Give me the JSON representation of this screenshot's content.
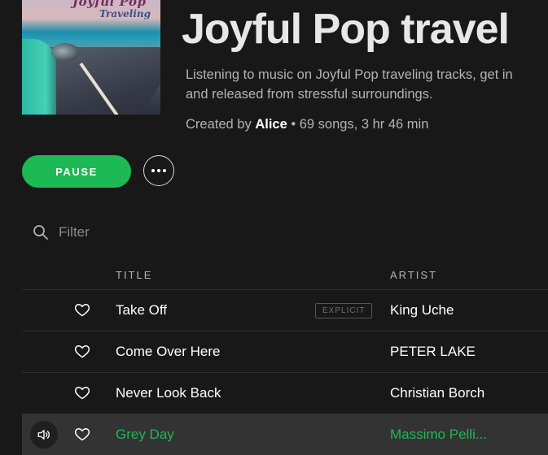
{
  "cover": {
    "line1": "Joyful Pop",
    "line2": "Traveling"
  },
  "playlist": {
    "title": "Joyful Pop travel",
    "description_line1": "Listening to music on Joyful Pop traveling tracks, get in",
    "description_line2": "and released from stressful surroundings.",
    "created_by": "Created by",
    "owner": "Alice",
    "stats": "• 69 songs, 3 hr 46 min"
  },
  "controls": {
    "pause_label": "PAUSE",
    "more_icon": "ellipsis-icon"
  },
  "filter": {
    "placeholder": "Filter",
    "icon": "search-icon"
  },
  "columns": {
    "title": "TITLE",
    "artist": "ARTIST"
  },
  "tracks": [
    {
      "title": "Take Off",
      "artist": "King Uche",
      "explicit": "EXPLICIT"
    },
    {
      "title": "Come Over Here",
      "artist": "PETER LAKE"
    },
    {
      "title": "Never Look Back",
      "artist": "Christian Borch"
    },
    {
      "title": "Grey Day",
      "artist": "Massimo Pelli...",
      "playing": true
    }
  ],
  "colors": {
    "accent": "#1db954",
    "background": "#181818",
    "playing_row": "#333333",
    "muted_text": "#b3b3b3"
  }
}
